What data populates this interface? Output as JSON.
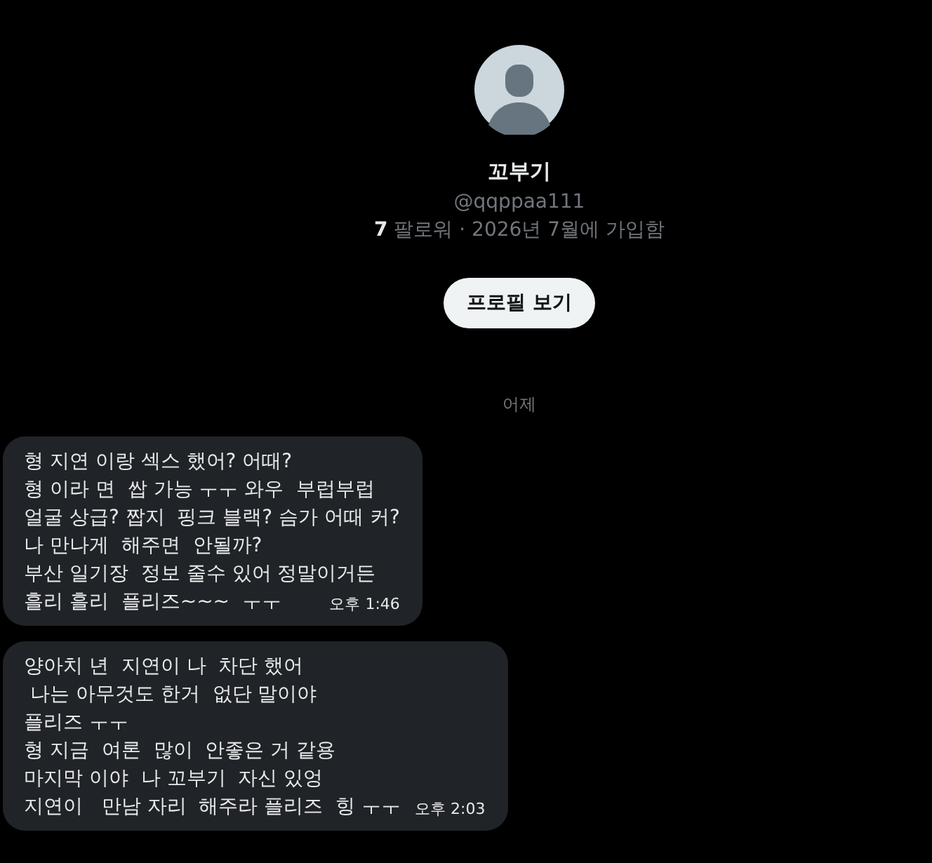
{
  "profile": {
    "name": "꼬부기",
    "handle": "@qqppaa111",
    "stats": "**7** 팔로워 · 2026년 7월에 가입함",
    "button": "프로필 보기"
  },
  "date_divider": "어제",
  "messages": [
    {
      "lines": [
        "형 지연 이랑 섹스 했어? 어때?",
        "형 이라 면  쌉 가능 ㅜㅜ 와우  부럽부럽",
        "얼굴 상급? 짭지  핑크 블랙? 슴가 어때 커?",
        "나 만나게  해주면  안될까?",
        "부산 일기장  정보 줄수 있어 정말이거든",
        "흘리 흘리  플리즈~~~  ㅜㅜ"
      ],
      "time": "오후 1:46"
    },
    {
      "lines": [
        "양아치 년  지연이 나  차단 했어",
        " 나는 아무것도 한거  없단 말이야",
        "플리즈 ㅜㅜ",
        "형 지금  여론  많이  안좋은 거 같용",
        "마지막 이야  나 꼬부기  자신 있엉",
        "지연이   만남 자리  해주라 플리즈  힝 ㅜㅜ"
      ],
      "time": "오후 2:03"
    }
  ]
}
